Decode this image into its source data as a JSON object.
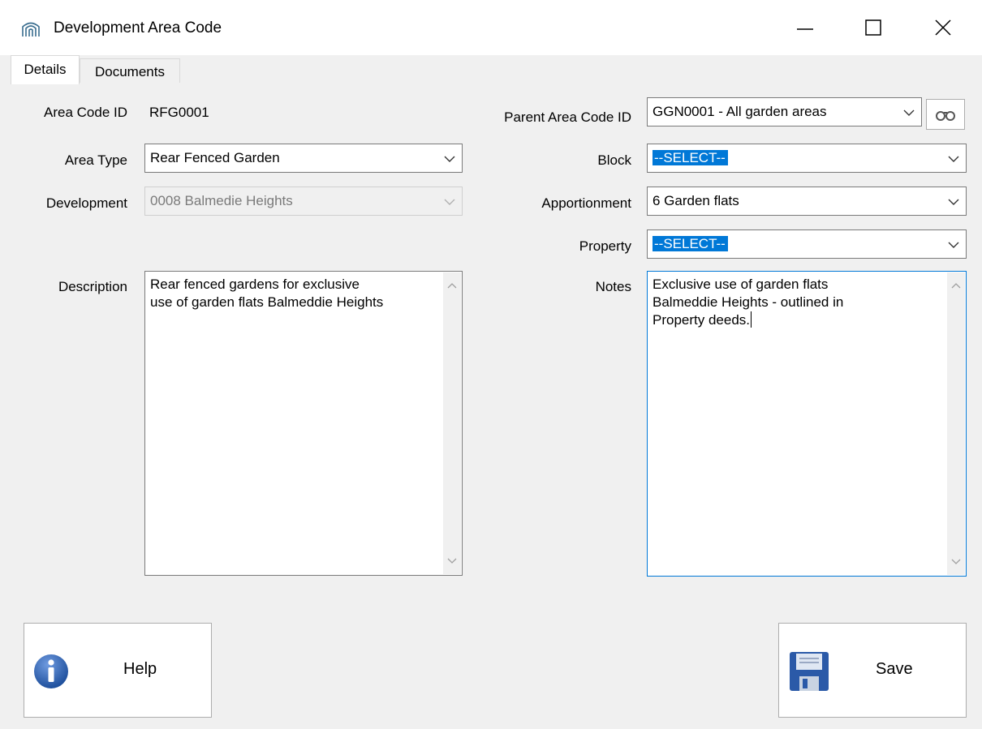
{
  "window": {
    "title": "Development Area Code",
    "icon": "building-arch-icon"
  },
  "tabs": [
    {
      "label": "Details",
      "selected": true
    },
    {
      "label": "Documents",
      "selected": false
    }
  ],
  "form": {
    "area_code_id": {
      "label": "Area Code ID",
      "value": "RFG0001"
    },
    "area_type": {
      "label": "Area Type",
      "value": "Rear Fenced Garden"
    },
    "development": {
      "label": "Development",
      "value": "0008  Balmedie Heights",
      "disabled": true
    },
    "description": {
      "label": "Description",
      "value": "Rear fenced gardens for exclusive\nuse of garden flats Balmeddie Heights"
    },
    "parent_area_code_id": {
      "label": "Parent Area Code ID",
      "value": "GGN0001 - All garden areas"
    },
    "block": {
      "label": "Block",
      "value": "--SELECT--"
    },
    "apportionment": {
      "label": "Apportionment",
      "value": "6  Garden flats"
    },
    "property": {
      "label": "Property",
      "value": "--SELECT--"
    },
    "notes": {
      "label": "Notes",
      "value": "Exclusive use of garden flats\nBalmeddie Heights - outlined in\nProperty deeds."
    }
  },
  "buttons": {
    "help": {
      "label": "Help",
      "icon": "info-icon"
    },
    "save": {
      "label": "Save",
      "icon": "floppy-disk-icon"
    }
  },
  "colors": {
    "selection": "#0078d7",
    "info_blue": "#1e4f9c",
    "floppy_blue": "#2b5aa8"
  }
}
